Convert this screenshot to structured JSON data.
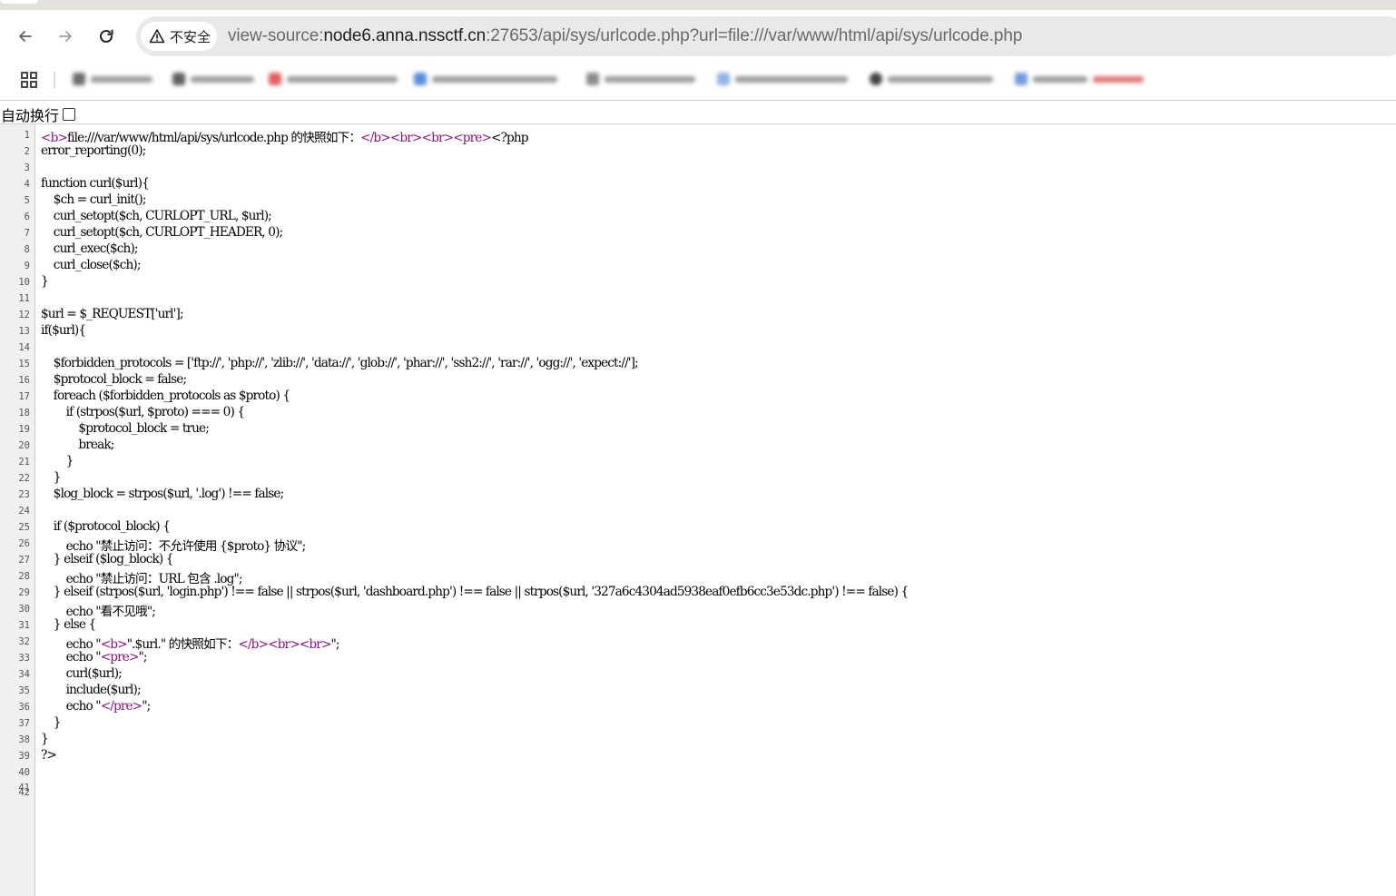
{
  "browser": {
    "security_chip": "不安全",
    "url_prefix": "view-source:",
    "url_host": "node6.anna.nssctf.cn",
    "url_rest": ":27653/api/sys/urlcode.php?url=file:///var/www/html/api/sys/urlcode.php",
    "icons": {
      "back": "arrow-left-icon",
      "forward": "arrow-right-icon",
      "reload": "reload-icon",
      "security": "warning-triangle-icon",
      "apps": "apps-grid-icon"
    }
  },
  "source_view": {
    "wrap_label": "自动换行",
    "wrap_checked": false,
    "lines": [
      {
        "n": "1",
        "text": "<b>file:///var/www/html/api/sys/urlcode.php 的快照如下：</b><br><br><pre><?php"
      },
      {
        "n": "2",
        "text": "error_reporting(0);"
      },
      {
        "n": "3",
        "text": ""
      },
      {
        "n": "4",
        "text": "function curl($url){"
      },
      {
        "n": "5",
        "text": "    $ch = curl_init();"
      },
      {
        "n": "6",
        "text": "    curl_setopt($ch, CURLOPT_URL, $url);"
      },
      {
        "n": "7",
        "text": "    curl_setopt($ch, CURLOPT_HEADER, 0);"
      },
      {
        "n": "8",
        "text": "    curl_exec($ch);"
      },
      {
        "n": "9",
        "text": "    curl_close($ch);"
      },
      {
        "n": "10",
        "text": "}"
      },
      {
        "n": "11",
        "text": ""
      },
      {
        "n": "12",
        "text": "$url = $_REQUEST['url'];"
      },
      {
        "n": "13",
        "text": "if($url){"
      },
      {
        "n": "14",
        "text": ""
      },
      {
        "n": "15",
        "text": "    $forbidden_protocols = ['ftp://', 'php://', 'zlib://', 'data://', 'glob://', 'phar://', 'ssh2://', 'rar://', 'ogg://', 'expect://'];"
      },
      {
        "n": "16",
        "text": "    $protocol_block = false;"
      },
      {
        "n": "17",
        "text": "    foreach ($forbidden_protocols as $proto) {"
      },
      {
        "n": "18",
        "text": "        if (strpos($url, $proto) === 0) {"
      },
      {
        "n": "19",
        "text": "            $protocol_block = true;"
      },
      {
        "n": "20",
        "text": "            break;"
      },
      {
        "n": "21",
        "text": "        }"
      },
      {
        "n": "22",
        "text": "    }"
      },
      {
        "n": "23",
        "text": "    $log_block = strpos($url, '.log') !== false;"
      },
      {
        "n": "24",
        "text": ""
      },
      {
        "n": "25",
        "text": "    if ($protocol_block) {"
      },
      {
        "n": "26",
        "text": "        echo \"禁止访问：不允许使用 {$proto} 协议\";"
      },
      {
        "n": "27",
        "text": "    } elseif ($log_block) {"
      },
      {
        "n": "28",
        "text": "        echo \"禁止访问：URL 包含 .log\";"
      },
      {
        "n": "29",
        "text": "    } elseif (strpos($url, 'login.php') !== false || strpos($url, 'dashboard.php') !== false || strpos($url, '327a6c4304ad5938eaf0efb6cc3e53dc.php') !== false) {"
      },
      {
        "n": "30",
        "text": "        echo \"看不见哦\";"
      },
      {
        "n": "31",
        "text": "    } else {"
      },
      {
        "n": "32",
        "text": "        echo \"<b>\".$url.\" 的快照如下：</b><br><br>\";"
      },
      {
        "n": "33",
        "text": "        echo \"<pre>\";"
      },
      {
        "n": "34",
        "text": "        curl($url);"
      },
      {
        "n": "35",
        "text": "        include($url);"
      },
      {
        "n": "36",
        "text": "        echo \"</pre>\";"
      },
      {
        "n": "37",
        "text": "    }"
      },
      {
        "n": "38",
        "text": "}"
      },
      {
        "n": "39",
        "text": "?>"
      },
      {
        "n": "40",
        "text": ""
      },
      {
        "n": "41",
        "text": ""
      },
      {
        "n": "42",
        "text": ""
      }
    ]
  }
}
